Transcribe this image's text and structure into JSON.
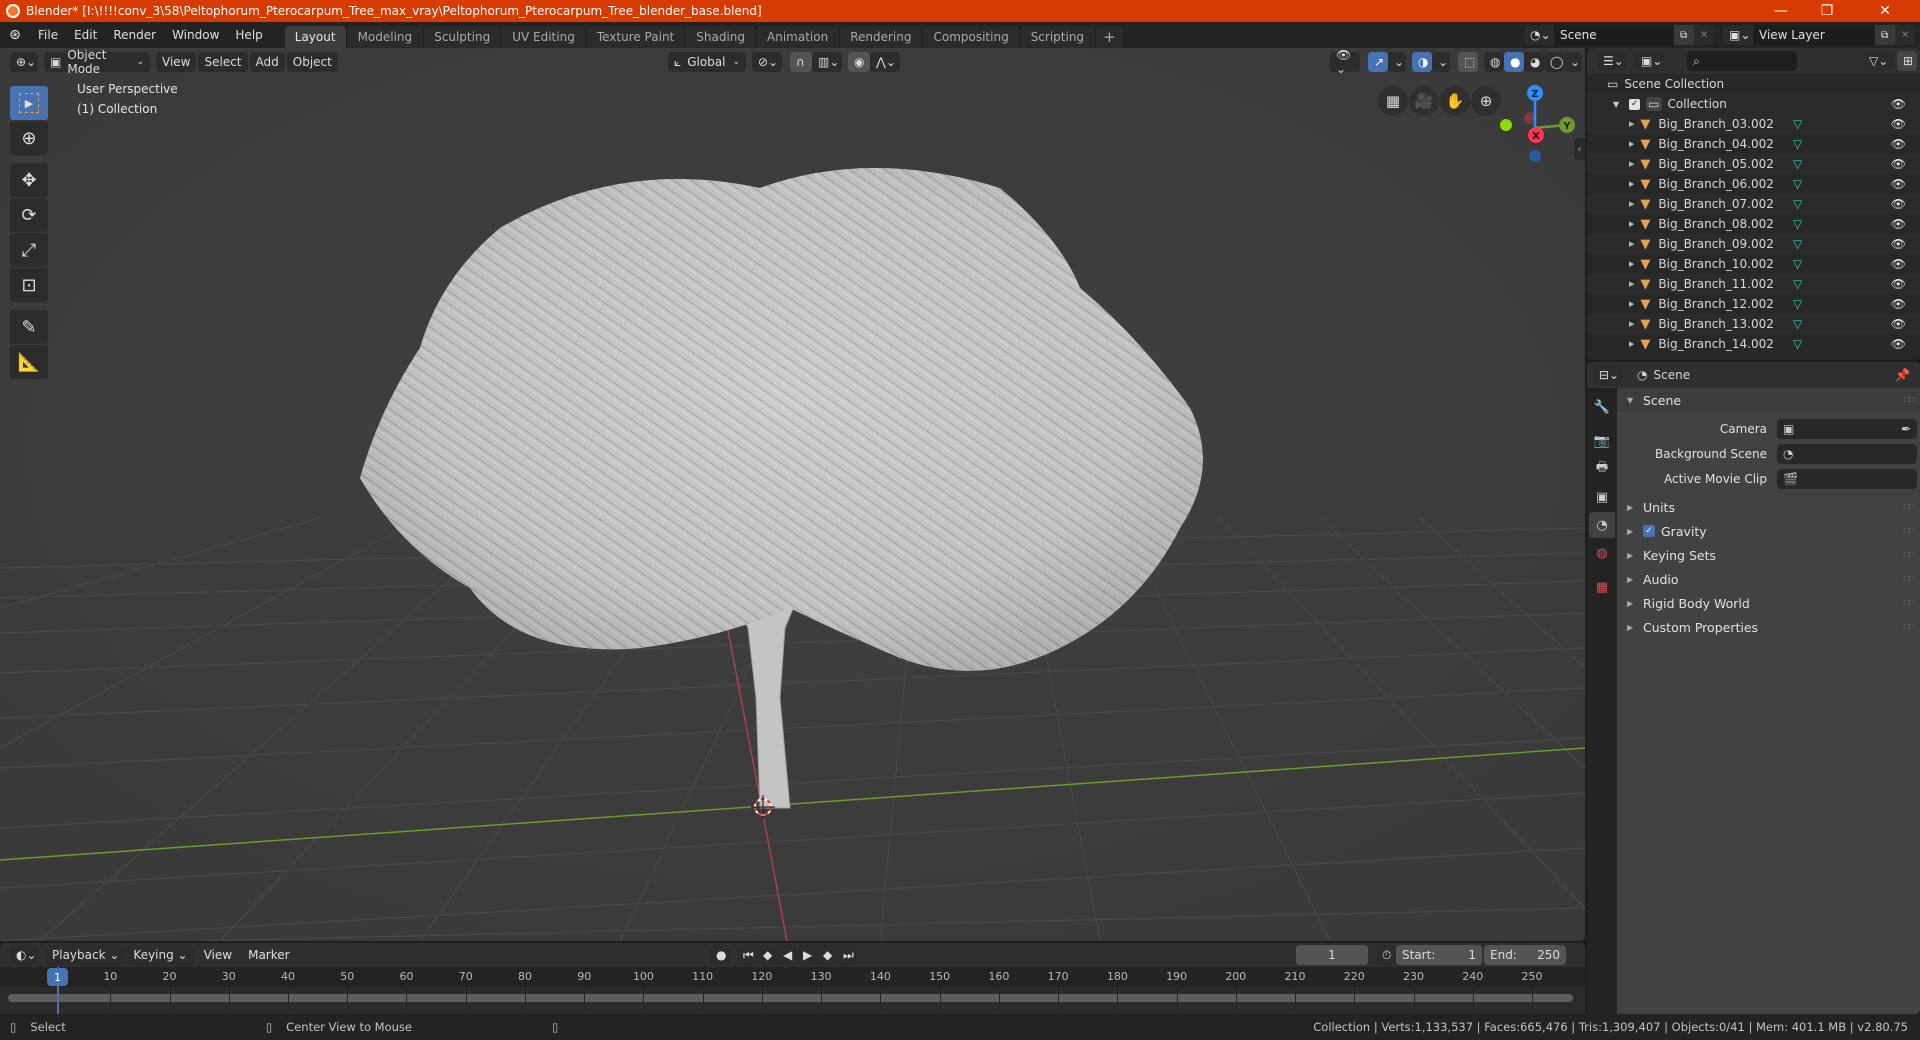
{
  "titlebar": {
    "title": "Blender* [I:\\!!!!conv_3\\58\\Peltophorum_Pterocarpum_Tree_max_vray\\Peltophorum_Pterocarpum_Tree_blender_base.blend]",
    "minimize": "—",
    "maximize": "❐",
    "close": "✕"
  },
  "menu": [
    "File",
    "Edit",
    "Render",
    "Window",
    "Help"
  ],
  "workspaces": [
    "Layout",
    "Modeling",
    "Sculpting",
    "UV Editing",
    "Texture Paint",
    "Shading",
    "Animation",
    "Rendering",
    "Compositing",
    "Scripting"
  ],
  "workspace_add": "+",
  "active_workspace": "Layout",
  "scene_selector": {
    "value": "Scene"
  },
  "viewlayer_selector": {
    "value": "View Layer"
  },
  "viewport": {
    "mode": "Object Mode",
    "menus": [
      "View",
      "Select",
      "Add",
      "Object"
    ],
    "orientation": "Global",
    "overlay_text_1": "User Perspective",
    "overlay_text_2": "(1) Collection",
    "gizmo": {
      "z": "Z",
      "y": "Y",
      "x": "X"
    },
    "colors": {
      "x_axis": "#ff3352",
      "y_axis": "#8bdc00",
      "z_axis": "#2890ff"
    }
  },
  "outliner": {
    "root": "Scene Collection",
    "collection": "Collection",
    "items": [
      "Big_Branch_03.002",
      "Big_Branch_04.002",
      "Big_Branch_05.002",
      "Big_Branch_06.002",
      "Big_Branch_07.002",
      "Big_Branch_08.002",
      "Big_Branch_09.002",
      "Big_Branch_10.002",
      "Big_Branch_11.002",
      "Big_Branch_12.002",
      "Big_Branch_13.002",
      "Big_Branch_14.002"
    ]
  },
  "properties": {
    "context": "Scene",
    "panel_scene": "Scene",
    "fields": [
      {
        "label": "Camera",
        "value": ""
      },
      {
        "label": "Background Scene",
        "value": ""
      },
      {
        "label": "Active Movie Clip",
        "value": ""
      }
    ],
    "panels": [
      "Units",
      "Gravity",
      "Keying Sets",
      "Audio",
      "Rigid Body World",
      "Custom Properties"
    ],
    "gravity_checked": true
  },
  "timeline": {
    "menus": [
      "Playback",
      "Keying",
      "View",
      "Marker"
    ],
    "current_frame": "1",
    "start_label": "Start:",
    "start": "1",
    "end_label": "End:",
    "end": "250",
    "ticks": [
      "1",
      "10",
      "20",
      "30",
      "40",
      "50",
      "60",
      "70",
      "80",
      "90",
      "100",
      "110",
      "120",
      "130",
      "140",
      "150",
      "160",
      "170",
      "180",
      "190",
      "200",
      "210",
      "220",
      "230",
      "240",
      "250"
    ]
  },
  "statusbar": {
    "left_action": "Select",
    "middle_action": "Center View to Mouse",
    "stats": "Collection | Verts:1,133,537 | Faces:665,476 | Tris:1,309,407 | Objects:0/41 | Mem: 401.1 MB | v2.80.75"
  }
}
